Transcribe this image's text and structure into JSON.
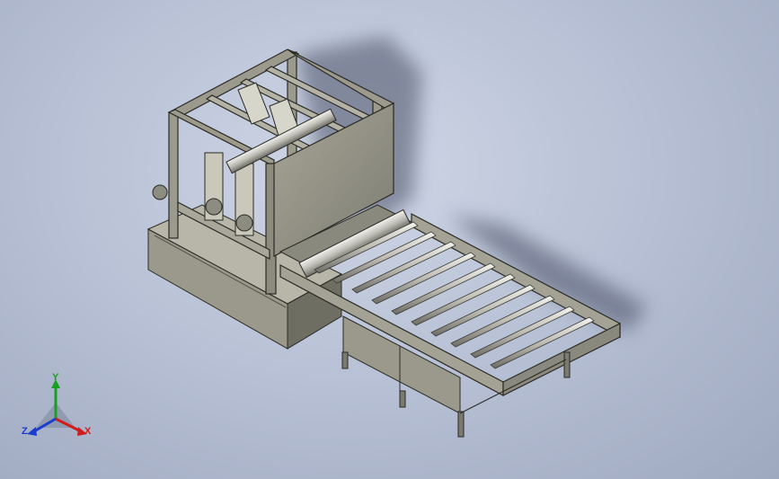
{
  "viewport": {
    "background_top": "#cfd6e6",
    "background_bottom": "#9ea8bf",
    "model_name": "machine-3d-assembly"
  },
  "triad": {
    "x_label": "X",
    "y_label": "Y",
    "z_label": "Z",
    "x_color": "#d01c1c",
    "y_color": "#18a020",
    "z_color": "#1c3cd0"
  }
}
